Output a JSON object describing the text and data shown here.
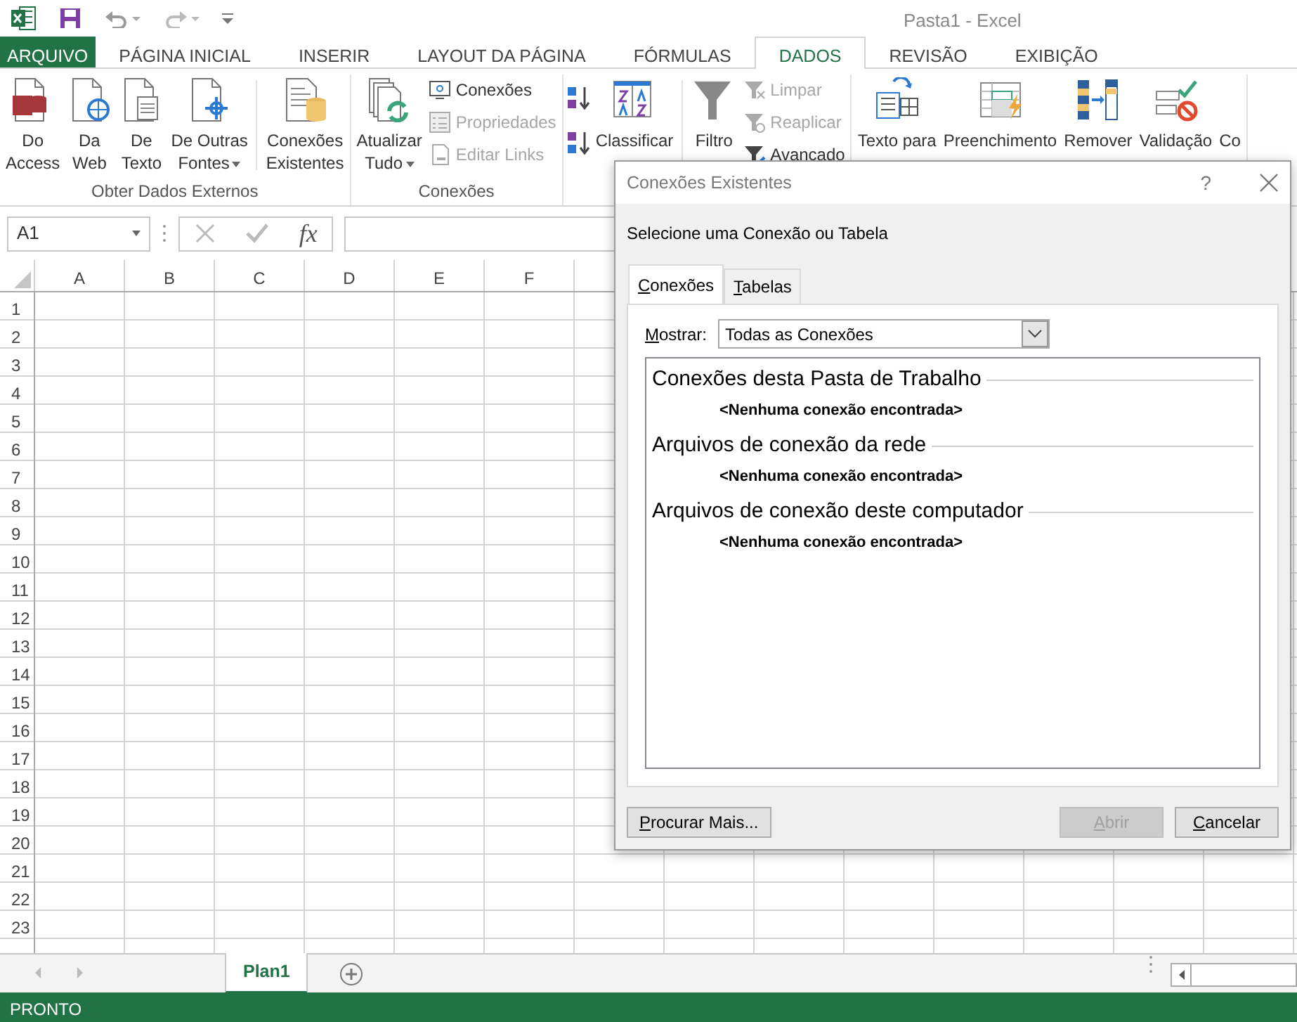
{
  "window": {
    "title": "Pasta1 - Excel"
  },
  "ribbon_tabs": [
    {
      "label": "ARQUIVO",
      "kind": "backstage",
      "selected": false
    },
    {
      "label": "PÁGINA INICIAL",
      "kind": "tab",
      "selected": false
    },
    {
      "label": "INSERIR",
      "kind": "tab",
      "selected": false
    },
    {
      "label": "LAYOUT DA PÁGINA",
      "kind": "tab",
      "selected": false
    },
    {
      "label": "FÓRMULAS",
      "kind": "tab",
      "selected": false
    },
    {
      "label": "DADOS",
      "kind": "tab",
      "selected": true
    },
    {
      "label": "REVISÃO",
      "kind": "tab",
      "selected": false
    },
    {
      "label": "EXIBIÇÃO",
      "kind": "tab",
      "selected": false
    }
  ],
  "ribbon_groups": [
    {
      "label": "Obter Dados Externos",
      "items": [
        {
          "kind": "large",
          "lines": [
            "Do",
            "Access"
          ],
          "dropdown": false
        },
        {
          "kind": "large",
          "lines": [
            "Da",
            "Web"
          ],
          "dropdown": false
        },
        {
          "kind": "large",
          "lines": [
            "De",
            "Texto"
          ],
          "dropdown": false
        },
        {
          "kind": "large",
          "lines": [
            "De Outras",
            "Fontes"
          ],
          "dropdown": true
        },
        {
          "kind": "separator"
        },
        {
          "kind": "large",
          "lines": [
            "Conexões",
            "Existentes"
          ],
          "dropdown": false
        }
      ]
    },
    {
      "label": "Conexões",
      "items": [
        {
          "kind": "large",
          "lines": [
            "Atualizar",
            "Tudo"
          ],
          "dropdown": true
        },
        {
          "kind": "stack",
          "entries": [
            {
              "label": "Conexões",
              "disabled": false
            },
            {
              "label": "Propriedades",
              "disabled": true
            },
            {
              "label": "Editar Links",
              "disabled": true
            }
          ]
        }
      ]
    },
    {
      "items": [
        {
          "kind": "sort-stack"
        },
        {
          "kind": "large",
          "lines": [
            "Classificar"
          ],
          "dropdown": false
        },
        {
          "kind": "separator"
        },
        {
          "kind": "large",
          "lines": [
            "Filtro"
          ],
          "dropdown": false
        },
        {
          "kind": "stack",
          "entries": [
            {
              "label": "Limpar",
              "disabled": true
            },
            {
              "label": "Reaplicar",
              "disabled": true
            },
            {
              "label": "Avancado",
              "disabled": false
            }
          ]
        }
      ]
    },
    {
      "items": [
        {
          "kind": "large",
          "lines": [
            "Texto para"
          ],
          "dropdown": false
        },
        {
          "kind": "large",
          "lines": [
            "Preenchimento"
          ],
          "dropdown": false
        },
        {
          "kind": "large",
          "lines": [
            "Remover"
          ],
          "dropdown": false
        },
        {
          "kind": "large",
          "lines": [
            "Validação"
          ],
          "dropdown": false
        },
        {
          "kind": "large",
          "lines": [
            "Co"
          ],
          "dropdown": false
        }
      ]
    }
  ],
  "formula_bar": {
    "name_box": "A1",
    "function_label": "fx"
  },
  "sheet": {
    "columns": [
      "A",
      "B",
      "C",
      "D",
      "E",
      "F"
    ],
    "rows": [
      "1",
      "2",
      "3",
      "4",
      "5",
      "6",
      "7",
      "8",
      "9",
      "10",
      "11",
      "12",
      "13",
      "14",
      "15",
      "16",
      "17",
      "18",
      "19",
      "20",
      "21",
      "22",
      "23"
    ]
  },
  "dialog": {
    "title": "Conexões Existentes",
    "help": "?",
    "prompt": "Selecione uma Conexão ou Tabela",
    "tabs": [
      {
        "label": "Conexões",
        "selected": true
      },
      {
        "label": "Tabelas",
        "selected": false
      }
    ],
    "show_label": "Mostrar:",
    "show_value": "Todas as Conexões",
    "sections": [
      {
        "heading": "Conexões desta Pasta de Trabalho",
        "empty_text": "<Nenhuma conexão encontrada>"
      },
      {
        "heading": "Arquivos de conexão da rede",
        "empty_text": "<Nenhuma conexão encontrada>"
      },
      {
        "heading": "Arquivos de conexão deste computador",
        "empty_text": "<Nenhuma conexão encontrada>"
      }
    ],
    "buttons": [
      {
        "label": "Procurar Mais...",
        "disabled": false
      },
      {
        "label": "Abrir",
        "disabled": true
      },
      {
        "label": "Cancelar",
        "disabled": false
      }
    ]
  },
  "sheet_tabs": [
    {
      "label": "Plan1",
      "selected": true
    }
  ],
  "status_bar": {
    "text": "PRONTO"
  }
}
